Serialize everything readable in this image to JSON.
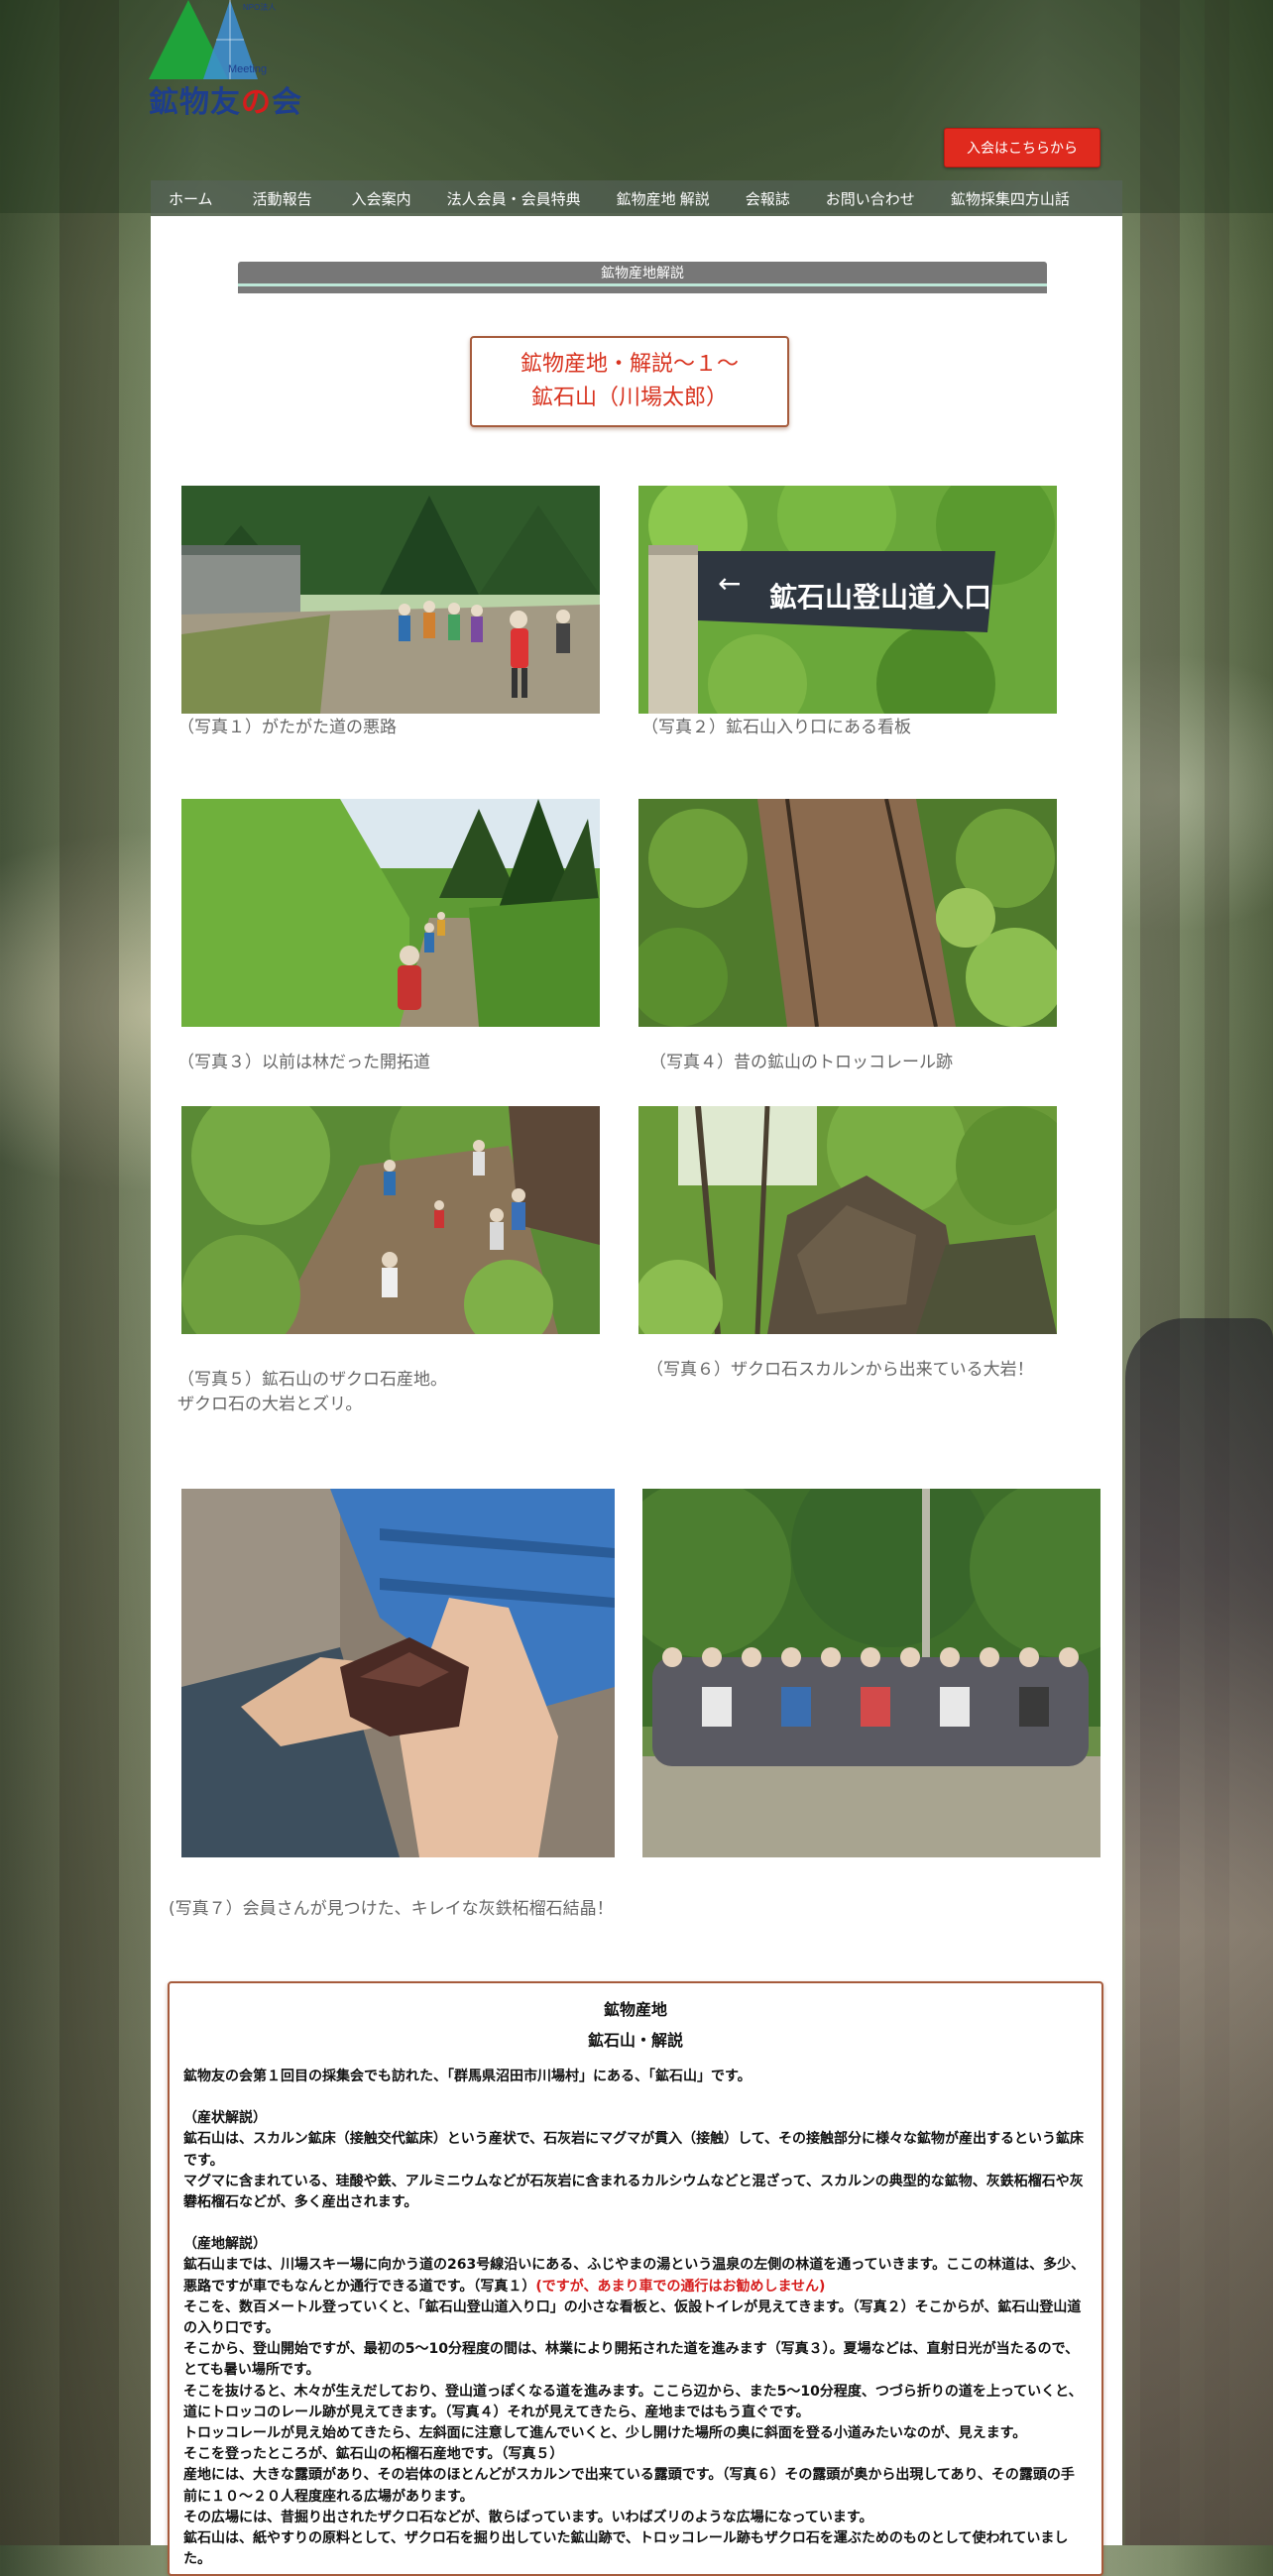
{
  "header": {
    "logo_text_main": "鉱物友",
    "logo_text_no": "の",
    "logo_text_end": "会",
    "logo_sub": "Meeting",
    "logo_npo": "NPO法人",
    "join_button": "入会はこちらから"
  },
  "nav": {
    "items": [
      {
        "label": "ホーム"
      },
      {
        "label": "活動報告"
      },
      {
        "label": "入会案内"
      },
      {
        "label": "法人会員・会員特典"
      },
      {
        "label": "鉱物産地 解説"
      },
      {
        "label": "会報誌"
      },
      {
        "label": "お問い合わせ"
      },
      {
        "label": "鉱物採集四方山話"
      }
    ]
  },
  "page": {
    "section_bar": "鉱物産地解説",
    "title_line1": "鉱物産地・解説～１～",
    "title_line2": "鉱石山（川場太郎）"
  },
  "photos": [
    {
      "caption": "（写真１）がたがた道の悪路"
    },
    {
      "caption": "（写真２）鉱石山入り口にある看板",
      "sign": "鉱石山登山道入口"
    },
    {
      "caption": "（写真３）以前は林だった開拓道"
    },
    {
      "caption": "（写真４）昔の鉱山のトロッコレール跡"
    },
    {
      "caption_line1": "（写真５）鉱石山のザクロ石産地。",
      "caption_line2": "ザクロ石の大岩とズリ。"
    },
    {
      "caption": "（写真６）ザクロ石スカルンから出来ている大岩！"
    },
    {
      "caption": "(写真７）会員さんが見つけた、キレイな灰鉄柘榴石結晶！"
    }
  ],
  "info": {
    "head1": "鉱物産地",
    "head2": "鉱石山・解説",
    "lead": "鉱物友の会第１回目の採集会でも訪れた、「群馬県沼田市川場村」にある、「鉱石山」です。",
    "s1_title": "（産状解説）",
    "s1_p1": "鉱石山は、スカルン鉱床（接触交代鉱床）という産状で、石灰岩にマグマが貫入（接触）して、その接触部分に様々な鉱物が産出するという鉱床です。",
    "s1_p2": "マグマに含まれている、珪酸や鉄、アルミニウムなどが石灰岩に含まれるカルシウムなどと混ざって、スカルンの典型的な鉱物、灰鉄柘榴石や灰礬柘榴石などが、多く産出されます。",
    "s2_title": "（産地解説）",
    "s2_p1a": "鉱石山までは、川場スキー場に向かう道の263号線沿いにある、ふじやまの湯という温泉の左側の林道を通っていきます。ここの林道は、多少、悪路ですが車でもなんとか通行できる道です。（写真１）",
    "s2_p1b": "(ですが、あまり車での通行はお勧めしません)",
    "s2_p2": "そこを、数百メートル登っていくと、「鉱石山登山道入り口」の小さな看板と、仮設トイレが見えてきます。（写真２）そこからが、鉱石山登山道の入り口です。",
    "s2_p3": "そこから、登山開始ですが、最初の5～10分程度の間は、林業により開拓された道を進みます（写真３）。夏場などは、直射日光が当たるので、とても暑い場所です。",
    "s2_p4": "そこを抜けると、木々が生えだしており、登山道っぽくなる道を進みます。ここら辺から、また5～10分程度、つづら折りの道を上っていくと、道にトロッコのレール跡が見えてきます。（写真４）それが見えてきたら、産地まではもう直ぐです。",
    "s2_p5": "トロッコレールが見え始めてきたら、左斜面に注意して進んでいくと、少し開けた場所の奥に斜面を登る小道みたいなのが、見えます。",
    "s2_p6": "そこを登ったところが、鉱石山の柘榴石産地です。（写真５）",
    "s2_p7": "産地には、大きな露頭があり、その岩体のほとんどがスカルンで出来ている露頭です。（写真６）その露頭が奥から出現してあり、その露頭の手前に１０～２０人程度座れる広場があります。",
    "s2_p8": "その広場には、昔掘り出されたザクロ石などが、散らばっています。いわばズリのような広場になっています。",
    "s2_p9": "鉱石山は、紙やすりの原料として、ザクロ石を掘り出していた鉱山跡で、トロッコレール跡もザクロ石を運ぶためのものとして使われていました。"
  }
}
